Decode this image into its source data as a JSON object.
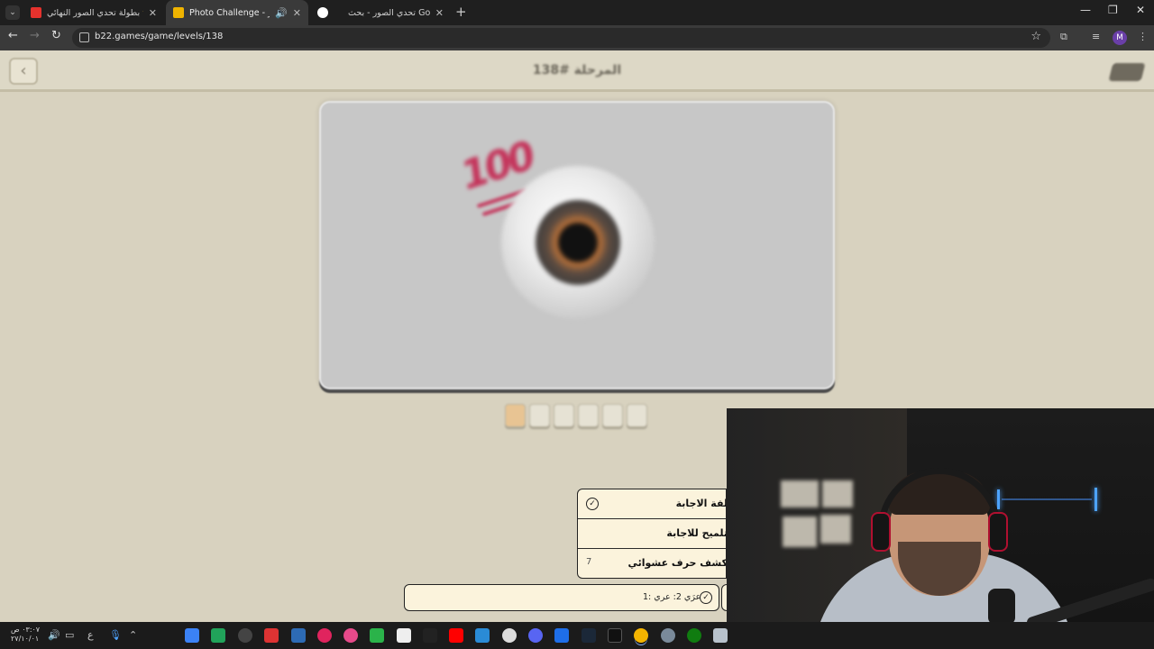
{
  "browser": {
    "tabs": [
      {
        "title": "بطولة تحدي الصور النهائي ⭐ 🌙"
      },
      {
        "title": "Photo Challenge - تحدي الصور"
      },
      {
        "title": ""
      },
      {
        "title": "تحدي الصور - بحث Google"
      }
    ],
    "url": "b22.games/game/levels/138",
    "profile_initial": "M"
  },
  "game": {
    "level_title": "المرحلة #138",
    "answer_boxes": 6,
    "help_menu": [
      {
        "label": "لفة الاجابة",
        "cost": ""
      },
      {
        "label": "تلميح للاجابة",
        "cost": ""
      },
      {
        "label": "كشف حرف عشوائي",
        "cost": "7"
      }
    ],
    "answer_hint_text": "1: عرَي 2: عري"
  },
  "taskbar": {
    "time": "٠٣:٠٧ ص",
    "date": "٢٧/١٠/٠١",
    "lang": "ع"
  },
  "colors": {
    "page_bg": "#d8d2bf",
    "card_bg": "#c7c7c7",
    "menu_bg": "#fbf3dc",
    "accent_pink": "#c4335a",
    "hint_box": "#e8c493"
  }
}
